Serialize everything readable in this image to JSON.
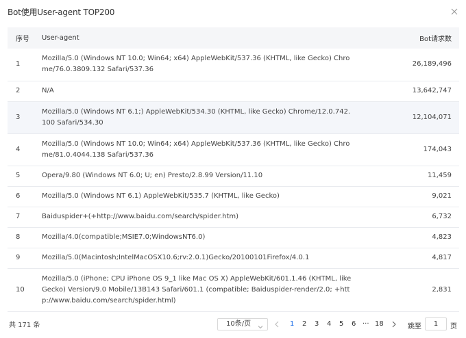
{
  "modal": {
    "title": "Bot使用User-agent TOP200"
  },
  "table": {
    "headers": {
      "rank": "序号",
      "ua": "User-agent",
      "count": "Bot请求数"
    },
    "rows": [
      {
        "rank": "1",
        "ua": "Mozilla/5.0 (Windows NT 10.0; Win64; x64) AppleWebKit/537.36 (KHTML, like Gecko) Chrome/76.0.3809.132 Safari/537.36",
        "count": "26,189,496"
      },
      {
        "rank": "2",
        "ua": "N/A",
        "count": "13,642,747"
      },
      {
        "rank": "3",
        "ua": "Mozilla/5.0 (Windows NT 6.1;) AppleWebKit/534.30 (KHTML, like Gecko) Chrome/12.0.742.100 Safari/534.30",
        "count": "12,104,071"
      },
      {
        "rank": "4",
        "ua": "Mozilla/5.0 (Windows NT 10.0; Win64; x64) AppleWebKit/537.36 (KHTML, like Gecko) Chrome/81.0.4044.138 Safari/537.36",
        "count": "174,043"
      },
      {
        "rank": "5",
        "ua": "Opera/9.80 (Windows NT 6.0; U; en) Presto/2.8.99 Version/11.10",
        "count": "11,459"
      },
      {
        "rank": "6",
        "ua": "Mozilla/5.0 (Windows NT 6.1) AppleWebKit/535.7 (KHTML, like Gecko)",
        "count": "9,021"
      },
      {
        "rank": "7",
        "ua": "Baiduspider+(+http://www.baidu.com/search/spider.htm)",
        "count": "6,732"
      },
      {
        "rank": "8",
        "ua": "Mozilla/4.0(compatible;MSIE7.0;WindowsNT6.0)",
        "count": "4,823"
      },
      {
        "rank": "9",
        "ua": "Mozilla/5.0(Macintosh;IntelMacOSX10.6;rv:2.0.1)Gecko/20100101Firefox/4.0.1",
        "count": "4,817"
      },
      {
        "rank": "10",
        "ua": "Mozilla/5.0 (iPhone; CPU iPhone OS 9_1 like Mac OS X) AppleWebKit/601.1.46 (KHTML, like Gecko) Version/9.0 Mobile/13B143 Safari/601.1 (compatible; Baiduspider-render/2.0; +http://www.baidu.com/search/spider.html)",
        "count": "2,831"
      }
    ]
  },
  "pagination": {
    "total": "共 171 条",
    "page_size": "10条/页",
    "pages": [
      "1",
      "2",
      "3",
      "4",
      "5",
      "6",
      "···",
      "18"
    ],
    "current": "1",
    "jump_label": "跳至",
    "jump_value": "1",
    "jump_unit": "页"
  },
  "colors": {
    "accent": "#1a6ce8",
    "header_bg": "#f5f6f8",
    "border": "#e9ebef"
  }
}
